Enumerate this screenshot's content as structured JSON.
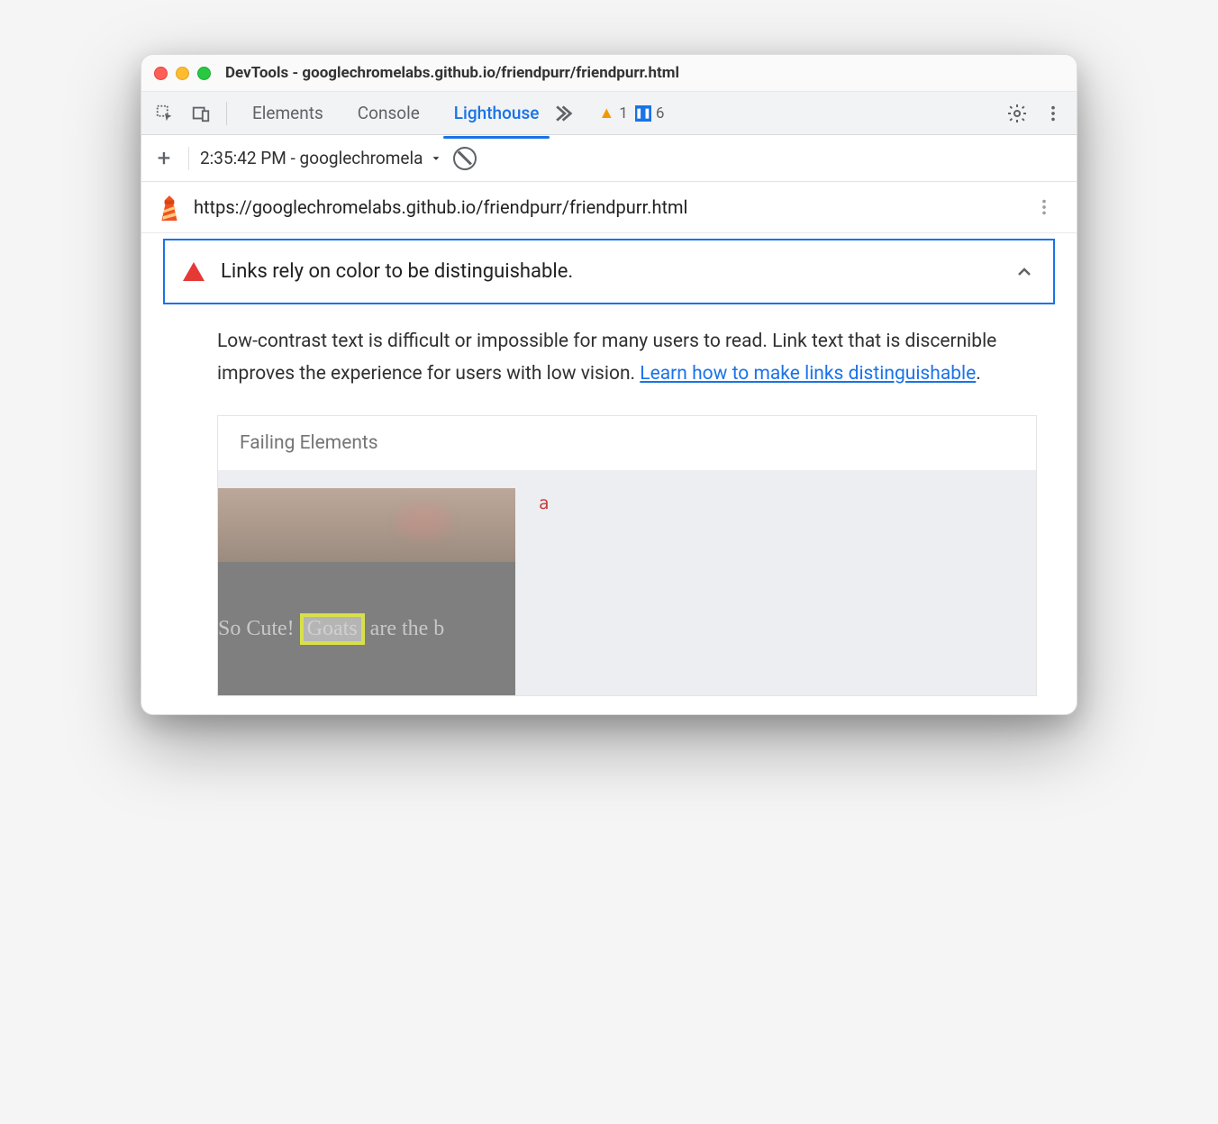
{
  "window": {
    "title": "DevTools - googlechromelabs.github.io/friendpurr/friendpurr.html"
  },
  "tabs": {
    "elements": "Elements",
    "console": "Console",
    "lighthouse": "Lighthouse"
  },
  "badges": {
    "warnings": "1",
    "info": "6"
  },
  "report": {
    "selected": "2:35:42 PM - googlechromela",
    "url": "https://googlechromelabs.github.io/friendpurr/friendpurr.html"
  },
  "audit": {
    "title": "Links rely on color to be distinguishable.",
    "description_pre": "Low-contrast text is difficult or impossible for many users to read. Link text that is discernible improves the experience for users with low vision. ",
    "learn_link": "Learn how to make links distinguishable",
    "failing_header": "Failing Elements",
    "element_tag": "a",
    "thumb_text_pre": "So Cute! ",
    "thumb_highlight": "Goats",
    "thumb_text_post": " are the b"
  }
}
